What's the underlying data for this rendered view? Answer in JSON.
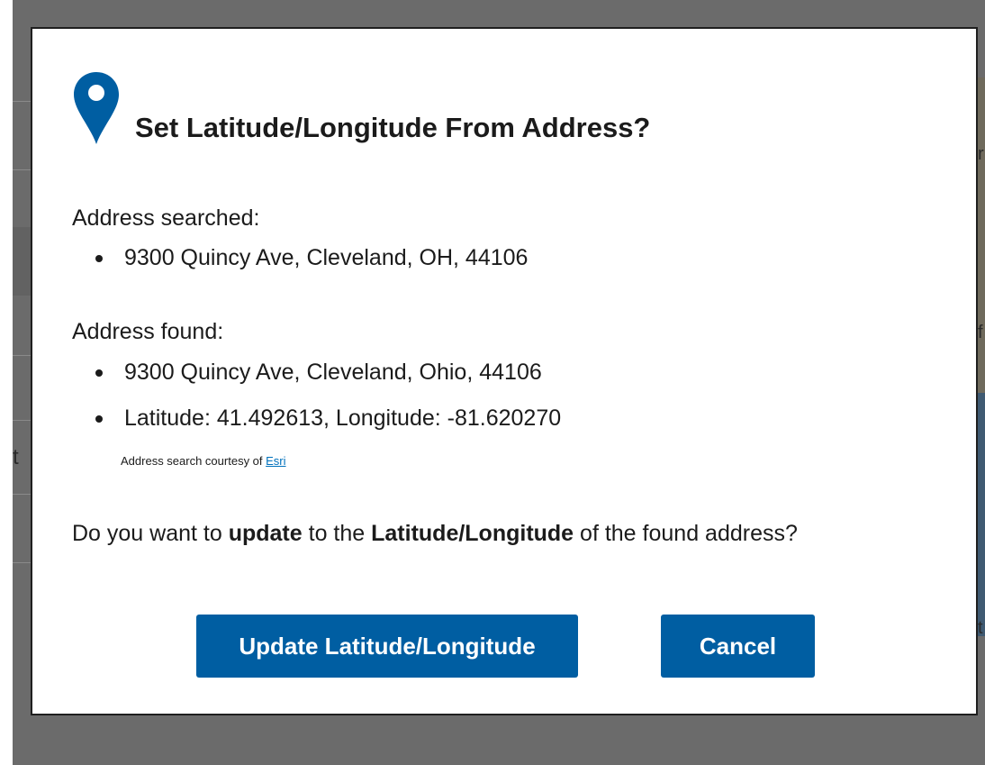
{
  "dialog": {
    "title": "Set Latitude/Longitude From Address?",
    "icon": "map-pin-icon",
    "accent_color": "#005ea2"
  },
  "address_searched": {
    "label": "Address searched:",
    "items": [
      "9300 Quincy Ave, Cleveland, OH, 44106"
    ]
  },
  "address_found": {
    "label": "Address found:",
    "items": [
      "9300 Quincy Ave, Cleveland, Ohio, 44106",
      "Latitude: 41.492613, Longitude: -81.620270"
    ]
  },
  "courtesy": {
    "prefix": "Address search courtesy of ",
    "link_text": "Esri"
  },
  "question": {
    "part1": "Do you want to ",
    "bold1": "update",
    "part2": " to the ",
    "bold2": "Latitude/Longitude",
    "part3": " of the found address?"
  },
  "buttons": {
    "update_label": "Update Latitude/Longitude",
    "cancel_label": "Cancel"
  },
  "background_fragments": [
    "t",
    "r",
    "f",
    "t"
  ]
}
